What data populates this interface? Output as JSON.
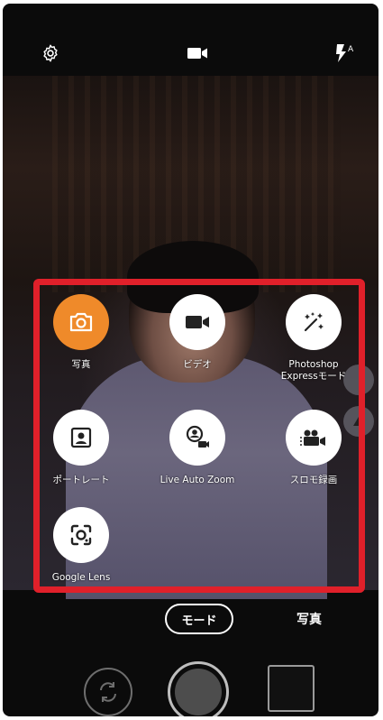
{
  "top_bar": {
    "settings_icon": "gear-icon",
    "video_icon": "video-camera-icon",
    "flash_icon": "flash-auto-icon",
    "flash_badge": "A"
  },
  "modes": [
    {
      "label": "写真",
      "icon": "camera-icon",
      "active": true
    },
    {
      "label": "ビデオ",
      "icon": "video-camera-icon",
      "active": false
    },
    {
      "label": "Photoshop\nExpressモード",
      "icon": "sparkle-wand-icon",
      "active": false
    },
    {
      "label": "ポートレート",
      "icon": "portrait-icon",
      "active": false
    },
    {
      "label": "Live Auto Zoom",
      "icon": "person-zoom-icon",
      "active": false
    },
    {
      "label": "スロモ録画",
      "icon": "slow-motion-icon",
      "active": false
    },
    {
      "label": "Google Lens",
      "icon": "lens-icon",
      "active": false
    }
  ],
  "bottom": {
    "mode_button_label": "モード",
    "current_mode_label": "写真"
  },
  "colors": {
    "highlight_box": "#e0202a",
    "active_mode": "#ef8a2a"
  }
}
